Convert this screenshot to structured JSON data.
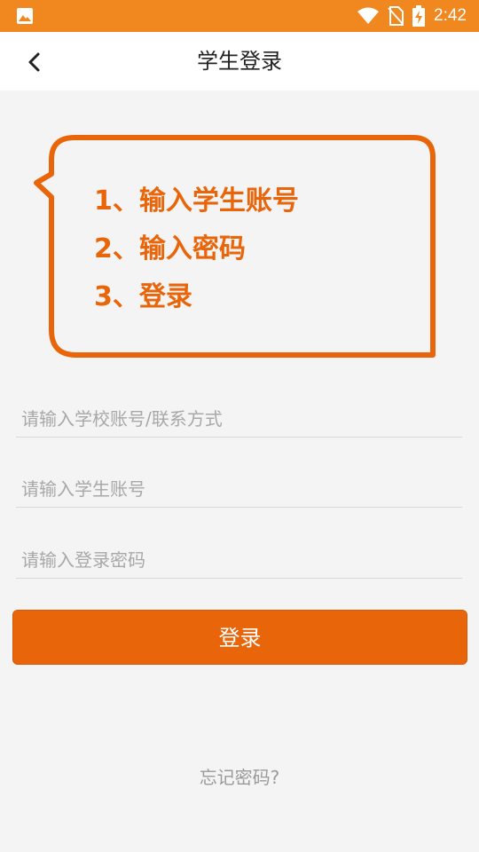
{
  "status_bar": {
    "time": "2:42",
    "icons": [
      "image-icon",
      "wifi-icon",
      "no-sim-icon",
      "battery-charging-icon"
    ],
    "color": "#f0871f"
  },
  "app_bar": {
    "title": "学生登录",
    "back_icon": "chevron-left-icon"
  },
  "tips": {
    "items": [
      "1、输入学生账号",
      "2、输入密码",
      "3、登录"
    ],
    "color": "#e9650a"
  },
  "form": {
    "school_placeholder": "请输入学校账号/联系方式",
    "student_placeholder": "请输入学生账号",
    "password_placeholder": "请输入登录密码",
    "login_label": "登录"
  },
  "forgot_password": "忘记密码?",
  "colors": {
    "accent": "#e9650a",
    "status_bar": "#f0871f",
    "background": "#f4f4f4"
  }
}
